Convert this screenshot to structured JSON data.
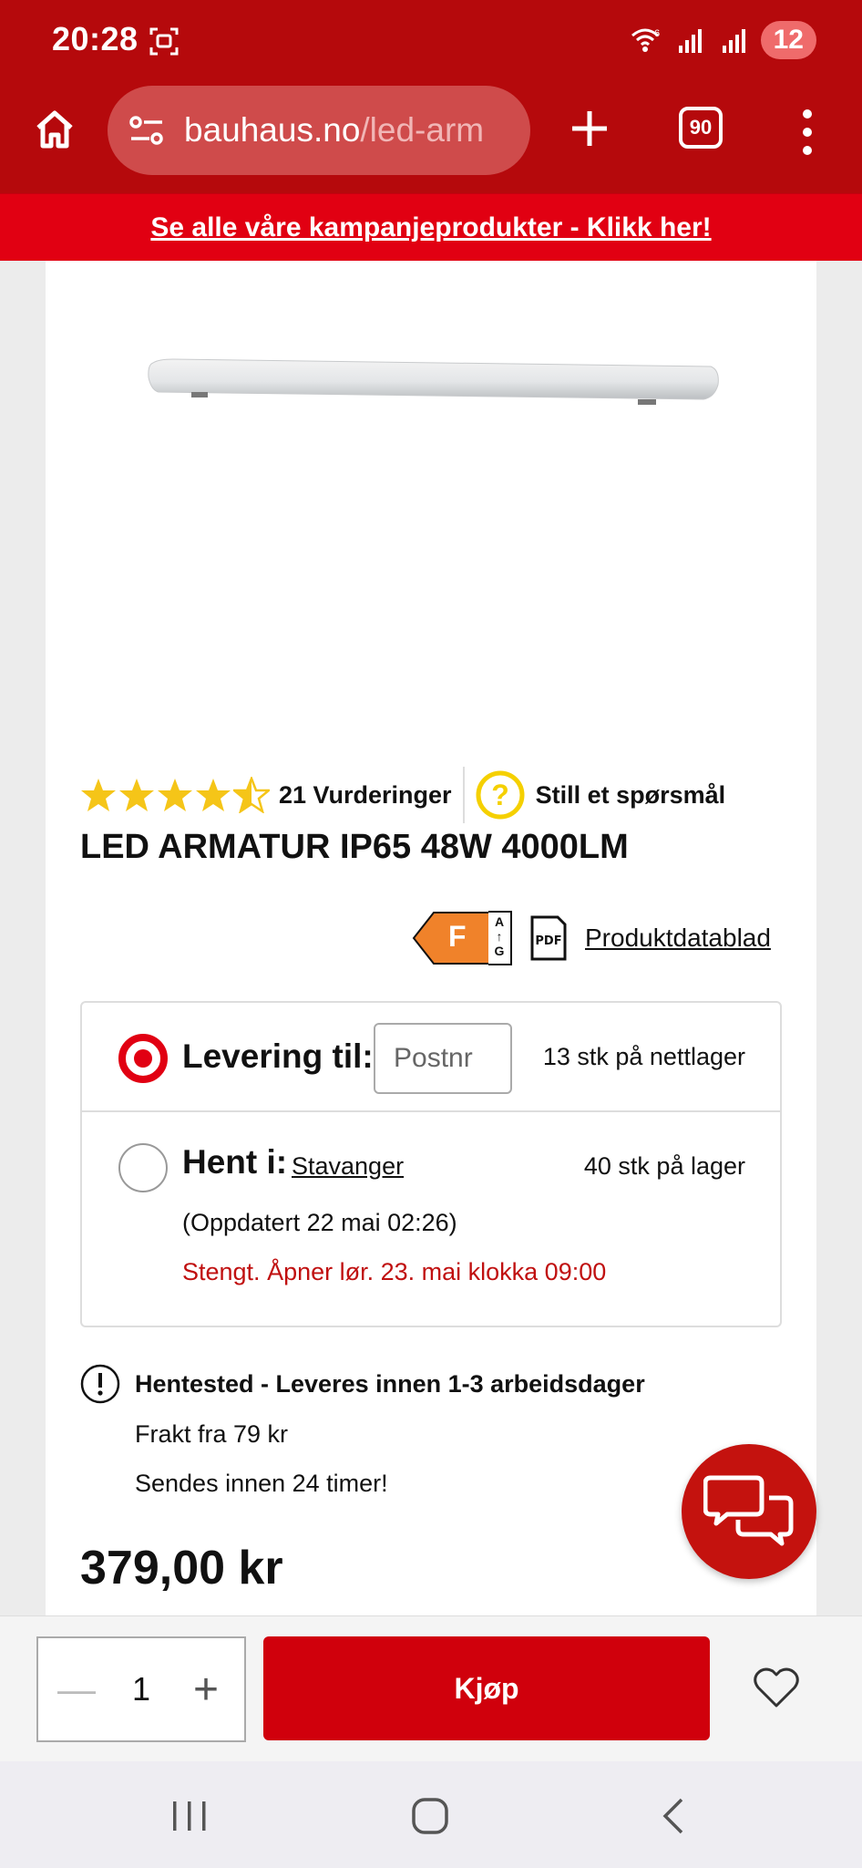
{
  "status_bar": {
    "time": "20:28",
    "notification_count": "12"
  },
  "browser": {
    "url_host": "bauhaus.no",
    "url_path": "/led-arm",
    "tab_count": "90"
  },
  "banner": {
    "text": "Se alle våre kampanjeprodukter - Klikk her!"
  },
  "product": {
    "rating_stars": 4.5,
    "rating_count_label": "21 Vurderinger",
    "ask_question_label": "Still et spørsmål",
    "title": "LED ARMATUR IP65 48W 4000LM",
    "energy_class": "F",
    "energy_scale_top": "A",
    "energy_scale_bottom": "G",
    "pdf_icon_text": "PDF",
    "datasheet_label": "Produktdatablad",
    "price": "379,00 kr"
  },
  "delivery": {
    "delivery_label": "Levering til:",
    "postal_placeholder": "Postnr",
    "online_stock": "13 stk på nettlager",
    "pickup_label": "Hent i:",
    "store_name": "Stavanger",
    "store_stock": "40 stk på lager",
    "updated": "(Oppdatert 22 mai 02:26)",
    "closed_notice": "Stengt. Åpner lør. 23. mai klokka 09:00"
  },
  "shipping": {
    "title": "Hentested - Leveres innen 1-3 arbeidsdager",
    "freight": "Frakt fra 79 kr",
    "dispatch": "Sendes innen 24 timer!"
  },
  "buy_bar": {
    "quantity": "1",
    "buy_label": "Kjøp"
  },
  "colors": {
    "brand_red": "#b5090c",
    "banner_red": "#e10012",
    "star_yellow": "#f5c518",
    "energy_orange": "#f0822a"
  }
}
